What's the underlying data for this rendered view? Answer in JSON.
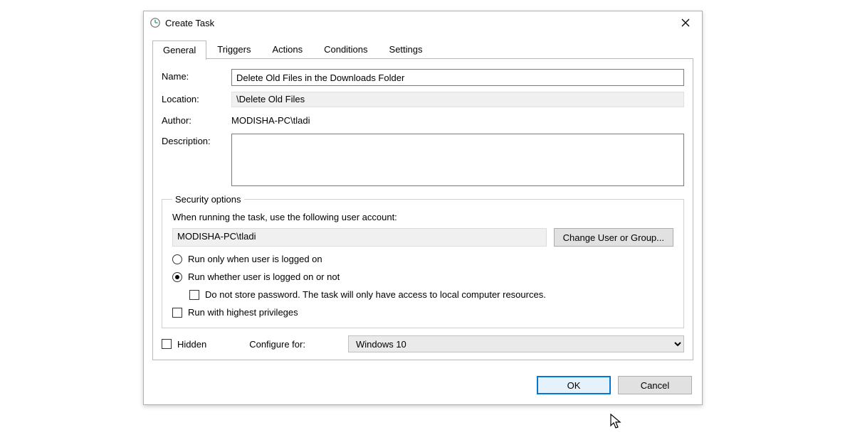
{
  "titlebar": {
    "title": "Create Task"
  },
  "tabs": [
    "General",
    "Triggers",
    "Actions",
    "Conditions",
    "Settings"
  ],
  "general": {
    "name_label": "Name:",
    "name_value": "Delete Old Files in the Downloads Folder",
    "location_label": "Location:",
    "location_value": "\\Delete Old Files",
    "author_label": "Author:",
    "author_value": "MODISHA-PC\\tladi",
    "description_label": "Description:",
    "description_value": ""
  },
  "security": {
    "legend": "Security options",
    "prompt": "When running the task, use the following user account:",
    "user_value": "MODISHA-PC\\tladi",
    "change_button": "Change User or Group...",
    "radio_logged_on": "Run only when user is logged on",
    "radio_whether": "Run whether user is logged on or not",
    "do_not_store": "Do not store password.  The task will only have access to local computer resources.",
    "highest_priv": "Run with highest privileges"
  },
  "footer_row": {
    "hidden_label": "Hidden",
    "configure_label": "Configure for:",
    "configure_value": "Windows 10"
  },
  "buttons": {
    "ok": "OK",
    "cancel": "Cancel"
  }
}
